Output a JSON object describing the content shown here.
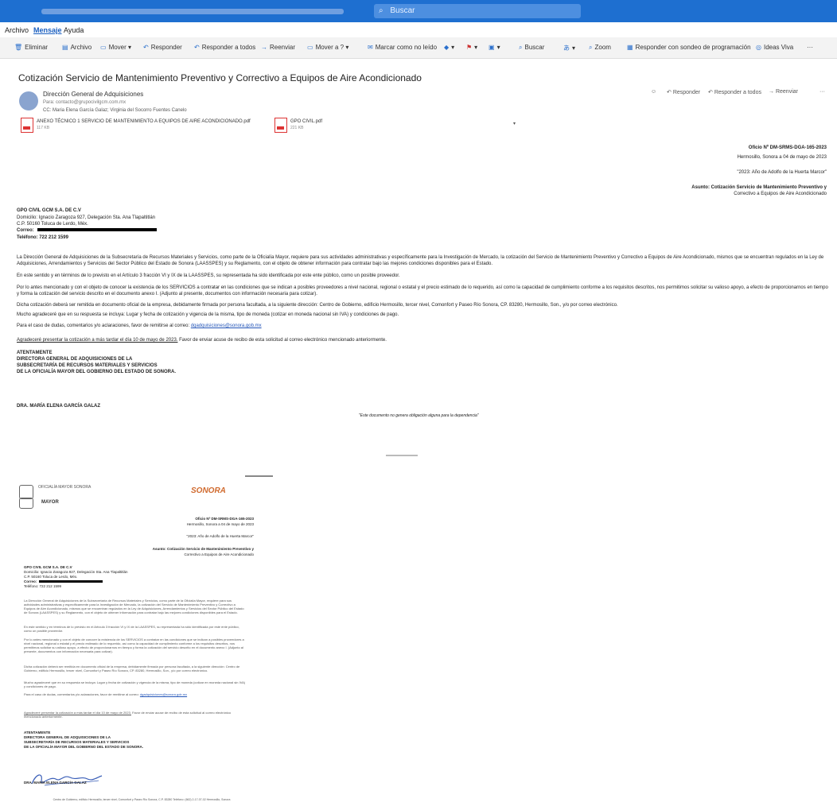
{
  "titlebar": {
    "search_placeholder": "Buscar"
  },
  "menu": {
    "file": "Archivo",
    "message": "Mensaje",
    "help": "Ayuda"
  },
  "toolbar": {
    "delete": "Eliminar",
    "archive": "Archivo",
    "move": "Mover",
    "reply": "Responder",
    "reply_all": "Responder a todos",
    "forward": "Reenviar",
    "move_to": "Mover a ?",
    "mark_unread": "Marcar como no leído",
    "search": "Buscar",
    "zoom": "Zoom",
    "reply_meeting": "Responder con sondeo de programación",
    "ideas": "Ideas Viva"
  },
  "email": {
    "subject": "Cotización Servicio de Mantenimiento Preventivo y Correctivo a Equipos de Aire Acondicionado",
    "sender": "Dirección General de Adquisiciones",
    "from": "Para: contacto@grupocivilgcm.com.mx",
    "to": "CC: Maria Elena García Galaz; Virginia del Socorro Fuentes Canelo",
    "actions": {
      "reply": "Responder",
      "reply_all": "Responder a todos",
      "forward": "Reenviar"
    },
    "attachments": [
      {
        "name": "ANEXO TÉCNICO 1 SERVICIO DE MANTENIMIENTO A EQUIPOS DE AIRE ACONDICIONADO.pdf",
        "size": "117 KB"
      },
      {
        "name": "GPO CIVIL.pdf",
        "size": "221 KB"
      }
    ]
  },
  "letter": {
    "oficio": "Oficio Nº DM-SRMS-DGA-165-2023",
    "place_date": "Hermosillo, Sonora a 04 de mayo de 2023",
    "year_motto": "\"2023: Año de Adolfo de la Huerta Marcor\"",
    "asunto_1": "Asunto: Cotización Servicio de Mantenimiento Preventivo y",
    "asunto_2": "Correctivo a Equipos de Aire Acondicionado",
    "company": "GPO CIVIL GCM S.A. DE C.V",
    "address_1": "Domicilio: Ignacio Zaragoza 927, Delegación Sta. Ana Tlapaltitlán",
    "address_2": "C.P. 50160 Toluca de Lerdo, Méx.",
    "correo_label": "Correo:",
    "phone": "Teléfono: 722 212 1599",
    "p1": "La Dirección General de Adquisiciones de la Subsecretaría de Recursos Materiales y Servicios, como parte de la Oficialía Mayor, requiere para sus actividades administrativas y específicamente para la Investigación de Mercado, la cotización del Servicio de Mantenimiento Preventivo y Correctivo a Equipos de Aire Acondicionado, mismos que se encuentran regulados en la Ley de Adquisiciones, Arrendamientos y Servicios del Sector Público del Estado de Sonora (LAASSPES) y su Reglamento, con el objeto de obtener información para contratar bajo las mejores condiciones disponibles para el Estado.",
    "p2": "En este sentido y en términos de lo previsto en el Artículo 3 fracción VI y IX de la LAASSPES, su representada ha sido identificada por este ente público, como un posible proveedor.",
    "p3": "Por lo antes mencionado y con el objeto de conocer la existencia de los SERVICIOS a contratar en las condiciones que se indican a posibles proveedores a nivel nacional, regional o estatal y el precio estimado de lo requerido, así como la capacidad de cumplimiento conforme a los requisitos descritos, nos permitimos solicitar su valioso apoyo, a efecto de proporcionarnos en tiempo y forma la cotización del servicio descrito en el documento anexo I. (Adjunto al presente, documentos con información necesaria para cotizar).",
    "p4": "Dicha cotización deberá ser remitida en documento oficial de la empresa, debidamente firmada por persona facultada, a la siguiente dirección: Centro de Gobierno, edificio Hermosillo, tercer nivel, Comonfort y Paseo Río Sonora, CP. 83280, Hermosillo, Son., y/o por correo electrónico.",
    "p5": "Mucho agradeceré que en su respuesta se incluya: Lugar y fecha de cotización y vigencia de la misma, tipo de moneda (cotizar en moneda nacional sin IVA) y condiciones de pago.",
    "p6": "Para el caso de dudas, comentarios y/o aclaraciones, favor de remitirse al correo:",
    "p6_email": "dgadquisiciones@sonora.gob.mx",
    "p7_underlined": "Agradeceré presentar la cotización a más tardar el día 10 de mayo de 2023.",
    "p7_rest": "Favor de enviar acuse de recibo de esta solicitud al correo electrónico mencionado anteriormente.",
    "sign_1": "ATENTAMENTE",
    "sign_2": "DIRECTORA GENERAL DE ADQUISICIONES DE LA",
    "sign_3": "SUBSECRETARÍA DE RECURSOS MATERIALES Y SERVICIOS",
    "sign_4": "DE LA OFICIALÍA MAYOR DEL GOBIERNO DEL ESTADO DE SONORA.",
    "signer": "DRA. MARÍA ELENA GARCÍA GALAZ",
    "footnote": "\"Este documento no genera obligación alguna para la dependencia\"",
    "logo_mayor": "MAYOR",
    "logo_sonora": "SONORA",
    "logo_top": "OFICIALÍA MAYOR SONORA",
    "address_footer": "Centro de Gobierno, edificio Hermosillo, tercer nivel, Comonfort y Paseo Río Sonora, C.P. 83280 Teléfono: (662) 2-17-07-02 Hermosillo, Sonora"
  }
}
